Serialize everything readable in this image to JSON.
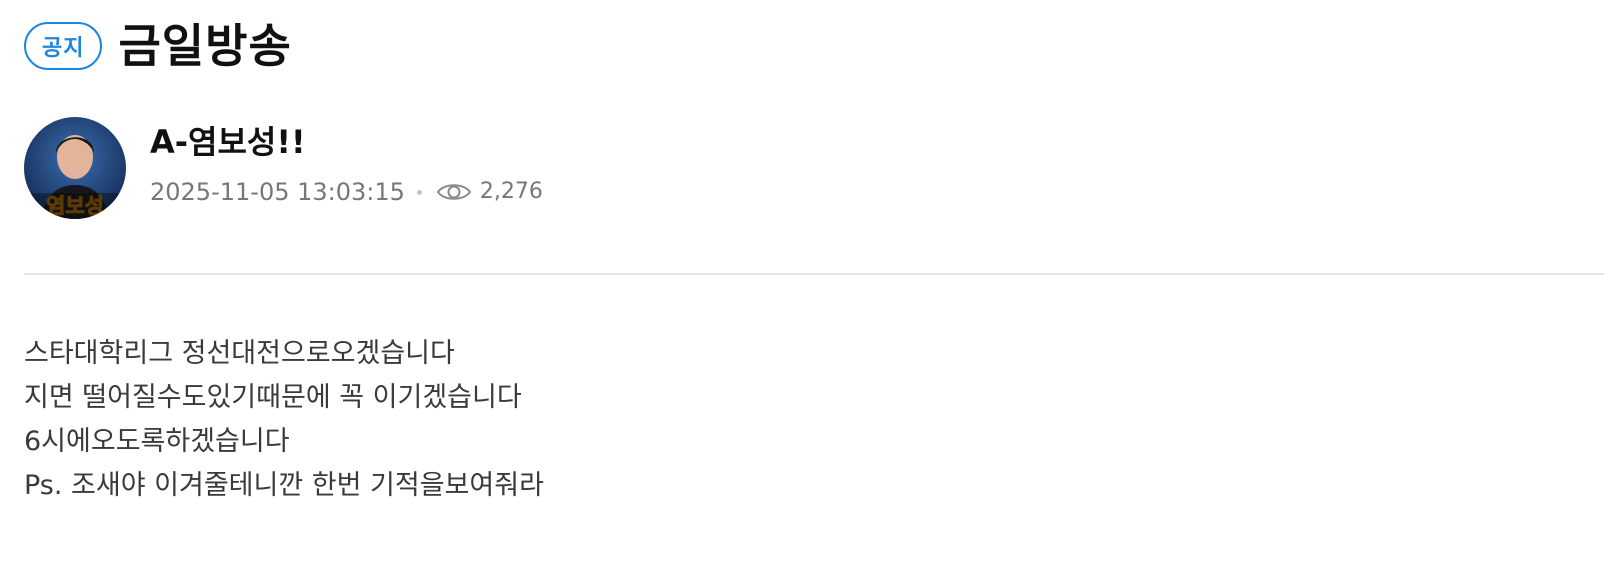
{
  "post": {
    "badge": "공지",
    "title": "금일방송"
  },
  "author": {
    "name": "A-염보성!!",
    "avatar_caption": "염보성",
    "avatar_icon": "user-avatar-photo"
  },
  "meta": {
    "datetime": "2025-11-05 13:03:15",
    "views_icon": "eye-icon",
    "views": "2,276"
  },
  "body": {
    "lines": [
      "스타대학리그 정선대전으로오겠습니다",
      "지면 떨어질수도있기때문에 꼭 이기겠습니다",
      "6시에오도록하겠습니다",
      "Ps. 조새야 이겨줄테니깐 한번 기적을보여줘라"
    ]
  },
  "colors": {
    "accent": "#1f86e0",
    "title": "#111111",
    "meta": "#777777",
    "divider": "#e3e3e3",
    "body_text": "#3a3a3a"
  }
}
